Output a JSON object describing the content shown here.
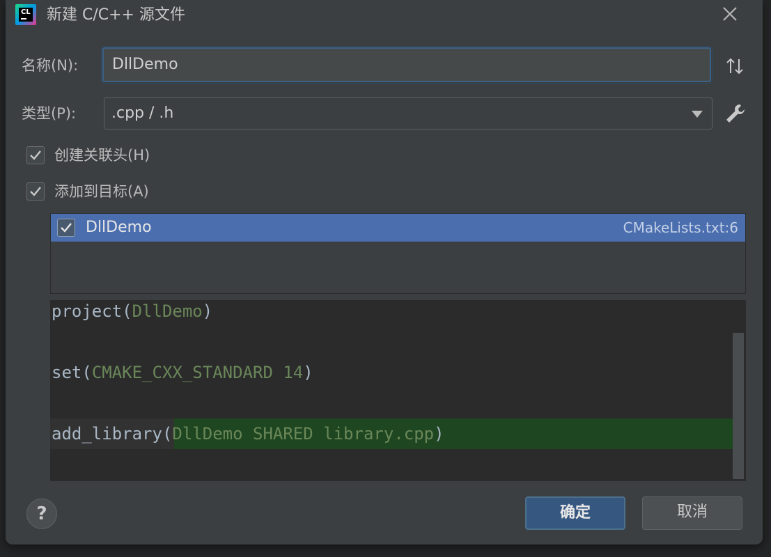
{
  "dialog": {
    "title": "新建 C/C++ 源文件",
    "app_icon_text": "CL"
  },
  "form": {
    "name_label": "名称(N):",
    "name_value": "DllDemo",
    "type_label": "类型(P):",
    "type_value": ".cpp / .h",
    "create_header_label": "创建关联头(H)",
    "create_header_checked": true,
    "add_to_target_label": "添加到目标(A)",
    "add_to_target_checked": true
  },
  "targets": [
    {
      "name": "DllDemo",
      "file": "CMakeLists.txt:6",
      "checked": true,
      "selected": true
    }
  ],
  "code_preview": {
    "lines": [
      {
        "fn": "project",
        "open": "(",
        "args": "DllDemo",
        "close": ")"
      },
      {
        "fn": "set",
        "open": "(",
        "args": "CMAKE_CXX_STANDARD 14",
        "close": ")"
      },
      {
        "fn": "add_library",
        "open": "(",
        "args": "DllDemo SHARED library.cpp",
        "close": ")",
        "highlighted": true
      }
    ]
  },
  "buttons": {
    "help_label": "?",
    "ok_label": "确定",
    "cancel_label": "取消"
  },
  "colors": {
    "background": "#3c3f41",
    "selection": "#4b6eaf",
    "code_background": "#2b2b2b",
    "code_arg": "#6a8759",
    "highlight_line": "#1e4620",
    "primary_button": "#365880"
  }
}
